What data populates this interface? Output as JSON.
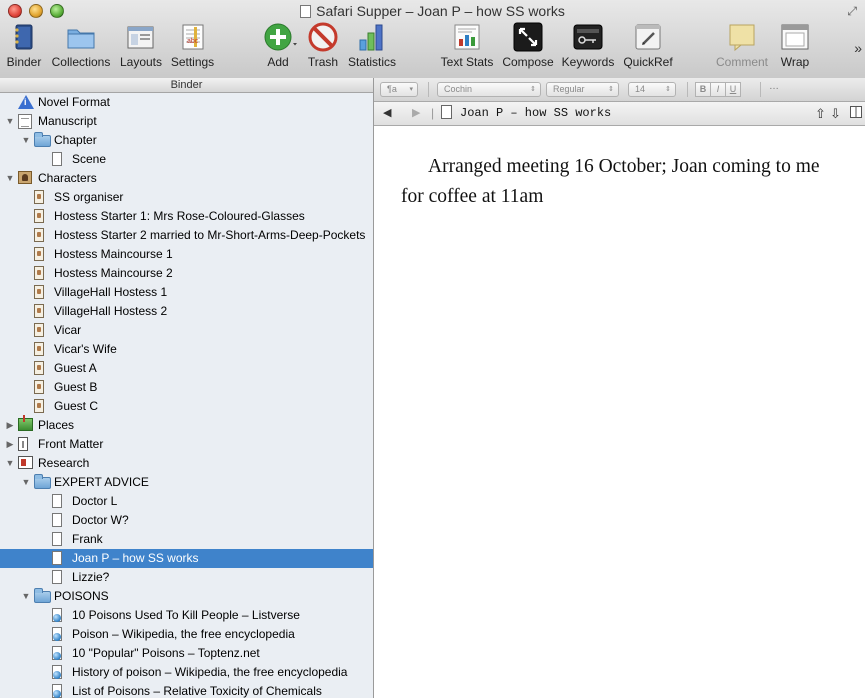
{
  "window": {
    "title": "Safari Supper – Joan P – how SS works"
  },
  "toolbar": {
    "items": [
      {
        "label": "Binder",
        "icon": "binder-icon"
      },
      {
        "label": "Collections",
        "icon": "collections-icon"
      },
      {
        "label": "Layouts",
        "icon": "layouts-icon"
      },
      {
        "label": "Settings",
        "icon": "settings-icon"
      },
      {
        "label": "Add",
        "icon": "add-icon"
      },
      {
        "label": "Trash",
        "icon": "trash-icon"
      },
      {
        "label": "Statistics",
        "icon": "statistics-icon"
      },
      {
        "label": "Text Stats",
        "icon": "text-stats-icon"
      },
      {
        "label": "Compose",
        "icon": "compose-icon"
      },
      {
        "label": "Keywords",
        "icon": "keywords-icon"
      },
      {
        "label": "QuickRef",
        "icon": "quickref-icon"
      },
      {
        "label": "Comment",
        "icon": "comment-icon"
      },
      {
        "label": "Wrap",
        "icon": "wrap-icon"
      }
    ],
    "overflow": "»"
  },
  "binder": {
    "header": "Binder",
    "items": [
      {
        "label": "Novel Format",
        "icon": "info-icon",
        "level": 0
      },
      {
        "label": "Manuscript",
        "icon": "manuscript-icon",
        "level": 0
      },
      {
        "label": "Chapter",
        "icon": "folder-icon",
        "level": 1
      },
      {
        "label": "Scene",
        "icon": "page-icon",
        "level": 2
      },
      {
        "label": "Characters",
        "icon": "characters-icon",
        "level": 0
      },
      {
        "label": "SS organiser",
        "icon": "character-card-icon",
        "level": 1
      },
      {
        "label": "Hostess Starter 1: Mrs Rose-Coloured-Glasses",
        "icon": "character-card-icon",
        "level": 1
      },
      {
        "label": "Hostess Starter 2 married to Mr-Short-Arms-Deep-Pockets",
        "icon": "character-card-icon",
        "level": 1
      },
      {
        "label": "Hostess Maincourse 1",
        "icon": "character-card-icon",
        "level": 1
      },
      {
        "label": "Hostess Maincourse 2",
        "icon": "character-card-icon",
        "level": 1
      },
      {
        "label": "VillageHall Hostess 1",
        "icon": "character-card-icon",
        "level": 1
      },
      {
        "label": "VillageHall Hostess 2",
        "icon": "character-card-icon",
        "level": 1
      },
      {
        "label": "Vicar",
        "icon": "character-card-icon",
        "level": 1
      },
      {
        "label": "Vicar's Wife",
        "icon": "character-card-icon",
        "level": 1
      },
      {
        "label": "Guest A",
        "icon": "character-card-icon",
        "level": 1
      },
      {
        "label": "Guest B",
        "icon": "character-card-icon",
        "level": 1
      },
      {
        "label": "Guest C",
        "icon": "character-card-icon",
        "level": 1
      },
      {
        "label": "Places",
        "icon": "places-icon",
        "level": 0
      },
      {
        "label": "Front Matter",
        "icon": "front-matter-icon",
        "level": 0
      },
      {
        "label": "Research",
        "icon": "research-icon",
        "level": 0
      },
      {
        "label": "EXPERT ADVICE",
        "icon": "folder-icon",
        "level": 1
      },
      {
        "label": "Doctor L",
        "icon": "page-icon",
        "level": 2
      },
      {
        "label": "Doctor W?",
        "icon": "page-icon",
        "level": 2
      },
      {
        "label": "Frank",
        "icon": "page-icon",
        "level": 2
      },
      {
        "label": "Joan P – how SS works",
        "icon": "page-icon",
        "level": 2,
        "selected": true
      },
      {
        "label": "Lizzie?",
        "icon": "page-icon",
        "level": 2
      },
      {
        "label": "POISONS",
        "icon": "folder-icon",
        "level": 1
      },
      {
        "label": "10 Poisons Used To Kill People – Listverse",
        "icon": "web-page-icon",
        "level": 2
      },
      {
        "label": "Poison – Wikipedia, the free encyclopedia",
        "icon": "web-page-icon",
        "level": 2
      },
      {
        "label": "10 \"Popular\" Poisons – Toptenz.net",
        "icon": "web-page-icon",
        "level": 2
      },
      {
        "label": "History of poison – Wikipedia, the free encyclopedia",
        "icon": "web-page-icon",
        "level": 2
      },
      {
        "label": "List of Poisons – Relative Toxicity of Chemicals",
        "icon": "web-page-icon",
        "level": 2
      }
    ]
  },
  "format_bar": {
    "paragraph_style": "¶a",
    "font_family": "Cochin",
    "font_style": "Regular",
    "font_size": "14",
    "bold": "B",
    "italic": "I",
    "underline": "U",
    "more": "…"
  },
  "editor": {
    "document_title": "Joan P – how SS works",
    "body": "Arranged meeting 16 October; Joan coming to me for coffee at 11am"
  },
  "colors": {
    "selection": "#3f83cb",
    "binder_background": "#eaeef3"
  }
}
